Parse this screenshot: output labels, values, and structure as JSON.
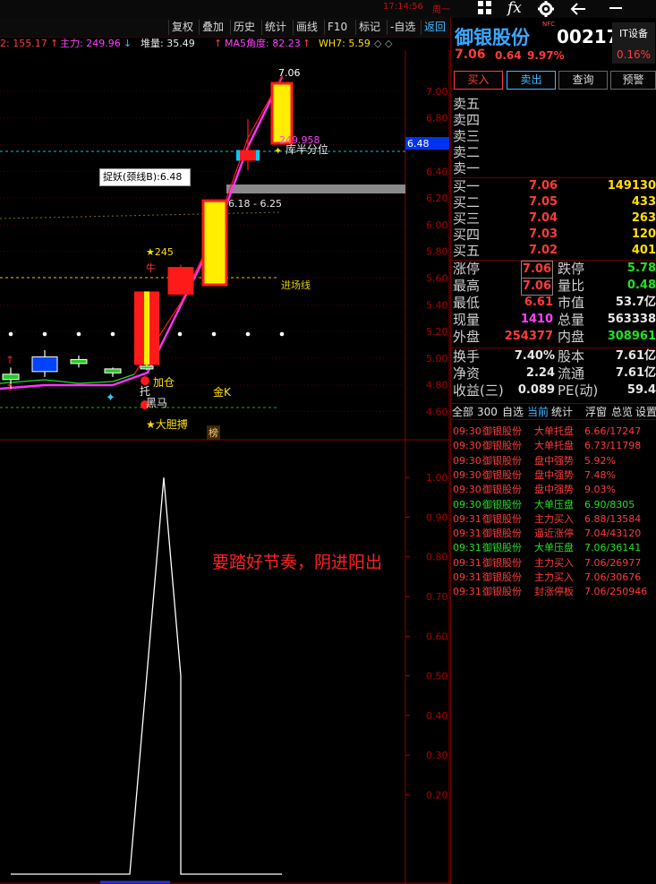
{
  "statusbar": {
    "clock": "17:14:56",
    "weekday": "周一",
    "fx_label": "fx"
  },
  "toolbar": {
    "items": [
      "复权",
      "叠加",
      "历史",
      "统计",
      "画线",
      "F10",
      "标记",
      "-自选",
      "返回"
    ]
  },
  "indicator_line": {
    "ma_value": "2: 155.17",
    "zhuli": "主力: 249.96",
    "duiliang": "堆量: 35.49",
    "ma5_angle": "MA5角度: 82.23",
    "wh7": "WH7: 5.59"
  },
  "price_axis": [
    "7.00",
    "6.80",
    "6.60",
    "6.40",
    "6.20",
    "6.00",
    "5.80",
    "5.60",
    "5.40",
    "5.20",
    "5.00",
    "4.80",
    "4.60"
  ],
  "lower_axis": [
    "1.00",
    "0.90",
    "0.80",
    "0.70",
    "0.60",
    "0.50",
    "0.40",
    "0.30",
    "0.20"
  ],
  "current_price_tag": "6.48",
  "chart_labels": {
    "high_label": "7.06",
    "zhuli_label": "249.958",
    "half_label": "库半分位",
    "neckline_box": "捉妖(颈线B):6.48",
    "range_label": "6.18 - 6.25",
    "entry_line": "进场线",
    "star_label": "★245",
    "niu": "牛",
    "jiacang": "加仓",
    "tuo": "托",
    "heima": "黑马",
    "dadanbo": "★大胆搏",
    "jink": "金K",
    "bang": "榜",
    "wei": "亿",
    "annotation": "要踏好节奏，阴进阳出"
  },
  "chart_data": {
    "type": "candlestick",
    "series": [
      {
        "open": 4.84,
        "high": 4.93,
        "low": 4.77,
        "close": 4.88
      },
      {
        "open": 4.9,
        "high": 5.06,
        "low": 4.86,
        "close": 5.01
      },
      {
        "open": 4.96,
        "high": 5.02,
        "low": 4.93,
        "close": 4.99
      },
      {
        "open": 4.89,
        "high": 4.93,
        "low": 4.86,
        "close": 4.92
      },
      {
        "open": 4.93,
        "high": 4.96,
        "low": 4.91,
        "close": 4.94
      },
      {
        "open": 4.95,
        "high": 5.5,
        "low": 4.95,
        "close": 5.5
      },
      {
        "open": 5.48,
        "high": 5.7,
        "low": 5.48,
        "close": 5.68
      },
      {
        "open": 5.55,
        "high": 6.18,
        "low": 5.55,
        "close": 6.18
      },
      {
        "open": 6.56,
        "high": 6.79,
        "low": 6.41,
        "close": 6.48
      },
      {
        "open": 6.61,
        "high": 7.06,
        "low": 6.61,
        "close": 7.06
      }
    ],
    "ylim": [
      4.55,
      7.1
    ],
    "entry_line": 5.6,
    "current_price": 6.48,
    "lower_series": [
      0,
      0,
      0,
      0,
      0,
      0,
      0.5,
      1.0,
      0.5,
      0,
      0,
      0
    ],
    "lower_ylim": [
      0,
      1.05
    ]
  },
  "stock": {
    "name": "御银股份",
    "code": "00217",
    "nfc": "NFC",
    "sector": "IT设备",
    "sector_change": "0.16%",
    "price": "7.06",
    "change": "0.64",
    "pct": "9.97%"
  },
  "buttons": [
    "买入",
    "卖出",
    "查询",
    "预警"
  ],
  "order_book": {
    "sell_labels": [
      "卖五",
      "卖四",
      "卖三",
      "卖二",
      "卖一"
    ],
    "buy": [
      {
        "label": "买一",
        "price": "7.06",
        "vol": "149130"
      },
      {
        "label": "买二",
        "price": "7.05",
        "vol": "433"
      },
      {
        "label": "买三",
        "price": "7.04",
        "vol": "263"
      },
      {
        "label": "买四",
        "price": "7.03",
        "vol": "120"
      },
      {
        "label": "买五",
        "price": "7.02",
        "vol": "401"
      }
    ]
  },
  "stats": [
    {
      "l1": "涨停",
      "v1": "7.06",
      "l2": "跌停",
      "v2": "5.78"
    },
    {
      "l1": "最高",
      "v1": "7.06",
      "l2": "量比",
      "v2": "0.48"
    },
    {
      "l1": "最低",
      "v1": "6.61",
      "l2": "市值",
      "v2": "53.7亿"
    },
    {
      "l1": "现量",
      "v1": "1410",
      "l2": "总量",
      "v2": "563338"
    },
    {
      "l1": "外盘",
      "v1": "254377",
      "l2": "内盘",
      "v2": "308961"
    }
  ],
  "stats2": [
    {
      "l1": "换手",
      "v1": "7.40%",
      "l2": "股本",
      "v2": "7.61亿"
    },
    {
      "l1": "净资",
      "v1": "2.24",
      "l2": "流通",
      "v2": "7.61亿"
    },
    {
      "l1": "收益(三)",
      "v1": "0.089",
      "l2": "PE(动)",
      "v2": "59.4"
    }
  ],
  "tabs": [
    "全部",
    "300",
    "自选",
    "当前",
    "统计",
    "浮窗",
    "总览",
    "设置"
  ],
  "trades": [
    {
      "time": "09:30",
      "name": "御银股份",
      "type": "大单托盘",
      "val": "6.66/17247",
      "color": "red"
    },
    {
      "time": "09:30",
      "name": "御银股份",
      "type": "大单托盘",
      "val": "6.73/11798",
      "color": "red"
    },
    {
      "time": "09:30",
      "name": "御银股份",
      "type": "盘中强势",
      "val": "5.92%",
      "color": "red"
    },
    {
      "time": "09:30",
      "name": "御银股份",
      "type": "盘中强势",
      "val": "7.48%",
      "color": "red"
    },
    {
      "time": "09:30",
      "name": "御银股份",
      "type": "盘中强势",
      "val": "9.03%",
      "color": "red"
    },
    {
      "time": "09:30",
      "name": "御银股份",
      "type": "大单压盘",
      "val": "6.90/8305",
      "color": "green"
    },
    {
      "time": "09:31",
      "name": "御银股份",
      "type": "主力买入",
      "val": "6.88/13584",
      "color": "red"
    },
    {
      "time": "09:31",
      "name": "御银股份",
      "type": "逼近涨停",
      "val": "7.04/43120",
      "color": "red"
    },
    {
      "time": "09:31",
      "name": "御银股份",
      "type": "大单压盘",
      "val": "7.06/36141",
      "color": "green"
    },
    {
      "time": "09:31",
      "name": "御银股份",
      "type": "主力买入",
      "val": "7.06/26977",
      "color": "red"
    },
    {
      "time": "09:31",
      "name": "御银股份",
      "type": "主力买入",
      "val": "7.06/30676",
      "color": "red"
    },
    {
      "time": "09:31",
      "name": "御银股份",
      "type": "封涨停板",
      "val": "7.06/250946",
      "color": "red"
    }
  ],
  "colors": {
    "up": "#ff1a1a",
    "candle_yellow": "#ffee00",
    "ma": "#ff33ff",
    "accent_blue": "#0044ff",
    "panel_red": "#8a0000"
  }
}
